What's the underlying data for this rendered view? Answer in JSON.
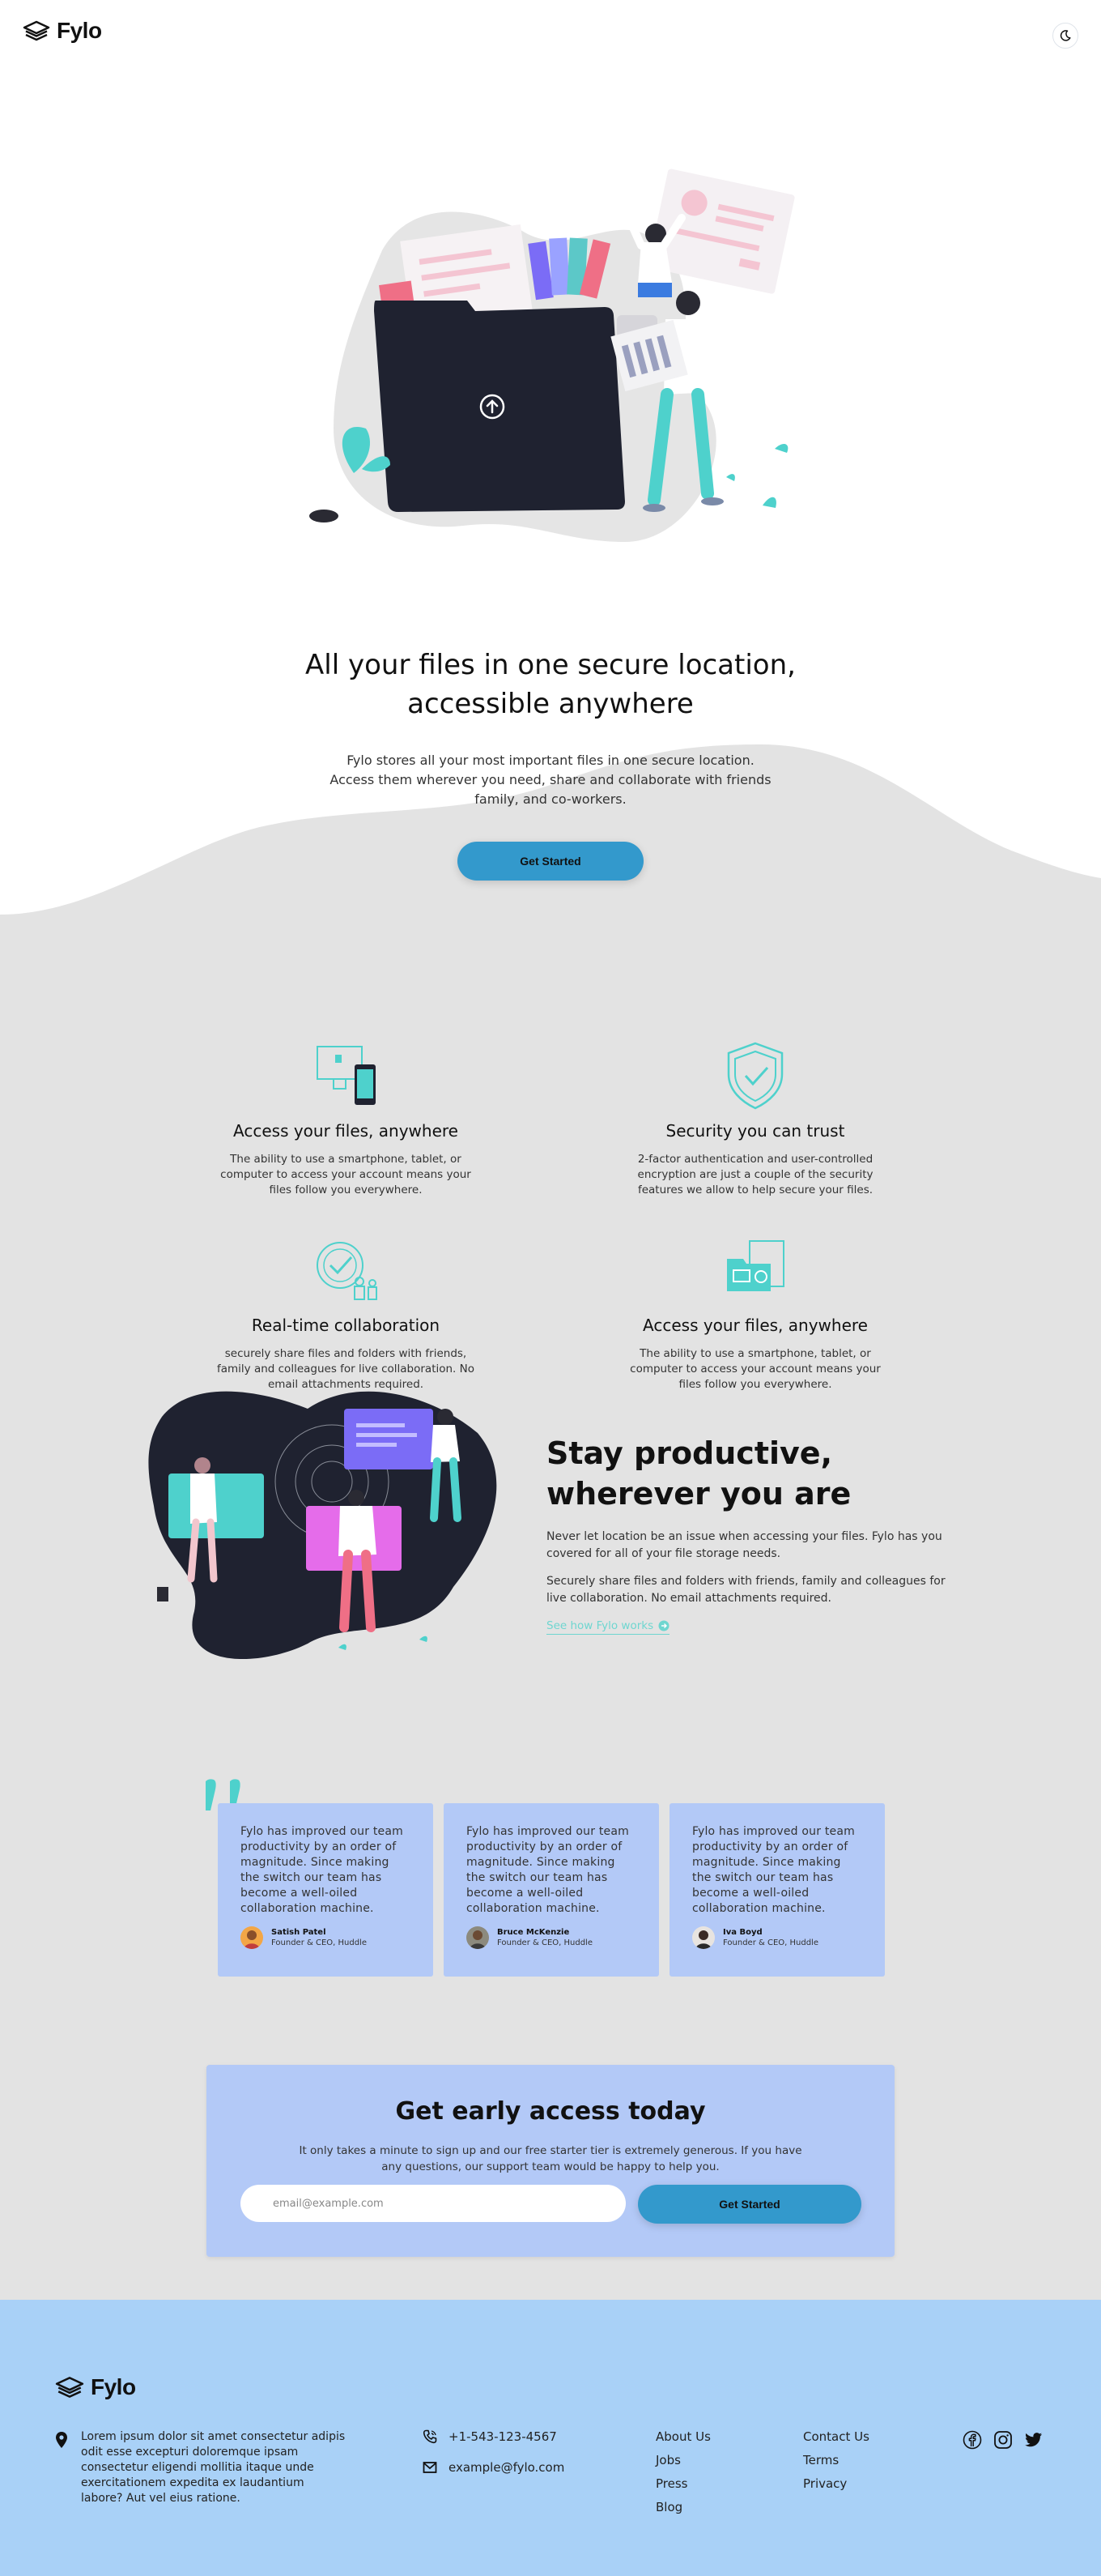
{
  "header": {
    "brand": "Fylo",
    "theme_toggle_icon": "moon-icon"
  },
  "hero": {
    "title": "All your files in one secure location, accessible anywhere",
    "subtitle": "Fylo stores all your most important files in one secure location. Access them wherever you need, share and collaborate with friends family, and co-workers.",
    "cta": "Get Started"
  },
  "features": [
    {
      "icon": "access-anywhere-icon",
      "title": "Access your files, anywhere",
      "text": "The ability to use a smartphone, tablet, or computer to access your account means your files follow you everywhere."
    },
    {
      "icon": "security-shield-icon",
      "title": "Security you can trust",
      "text": "2-factor authentication and user-controlled encryption are just a couple of the security features we allow to help secure your files."
    },
    {
      "icon": "collaboration-icon",
      "title": "Real-time collaboration",
      "text": "securely share files and folders with friends, family and colleagues for live collaboration. No email attachments required."
    },
    {
      "icon": "store-any-file-icon",
      "title": "Access your files, anywhere",
      "text": "The ability to use a smartphone, tablet, or computer to access your account means your files follow you everywhere."
    }
  ],
  "productive": {
    "title": "Stay productive, wherever you are",
    "p1": "Never let location be an issue when accessing your files. Fylo has you covered for all of your file storage needs.",
    "p2": "Securely share files and folders with friends, family and colleagues for live collaboration. No email attachments required.",
    "link": "See how Fylo works"
  },
  "testimonials": [
    {
      "quote": "Fylo has improved our team productivity by an order of magnitude. Since making the switch our team has become a well-oiled collaboration machine.",
      "name": "Satish Patel",
      "role": "Founder & CEO, Huddle"
    },
    {
      "quote": "Fylo has improved our team productivity by an order of magnitude. Since making the switch our team has become a well-oiled collaboration machine.",
      "name": "Bruce McKenzie",
      "role": "Founder & CEO, Huddle"
    },
    {
      "quote": "Fylo has improved our team productivity by an order of magnitude. Since making the switch our team has become a well-oiled collaboration machine.",
      "name": "Iva Boyd",
      "role": "Founder & CEO, Huddle"
    }
  ],
  "early_access": {
    "title": "Get early access today",
    "text": "It only takes a minute to sign up and our free starter tier is extremely generous. If you have any questions, our support team would be happy to help you.",
    "email_placeholder": "email@example.com",
    "cta": "Get Started"
  },
  "footer": {
    "brand": "Fylo",
    "address": "Lorem ipsum dolor sit amet consectetur adipis odit esse excepturi doloremque ipsam consectetur eligendi mollitia itaque unde exercitationem expedita ex laudantium labore? Aut vel eius ratione.",
    "phone": "+1-543-123-4567",
    "email": "example@fylo.com",
    "links_col1": [
      "About Us",
      "Jobs",
      "Press",
      "Blog"
    ],
    "links_col2": [
      "Contact Us",
      "Terms",
      "Privacy"
    ],
    "socials": [
      "facebook-icon",
      "instagram-icon",
      "twitter-icon"
    ]
  },
  "colors": {
    "accent": "#3399cc",
    "teal": "#6fd6d0",
    "card": "#b3c9f7",
    "footer": "#a9d1f7",
    "background": "#e3e3e3"
  }
}
